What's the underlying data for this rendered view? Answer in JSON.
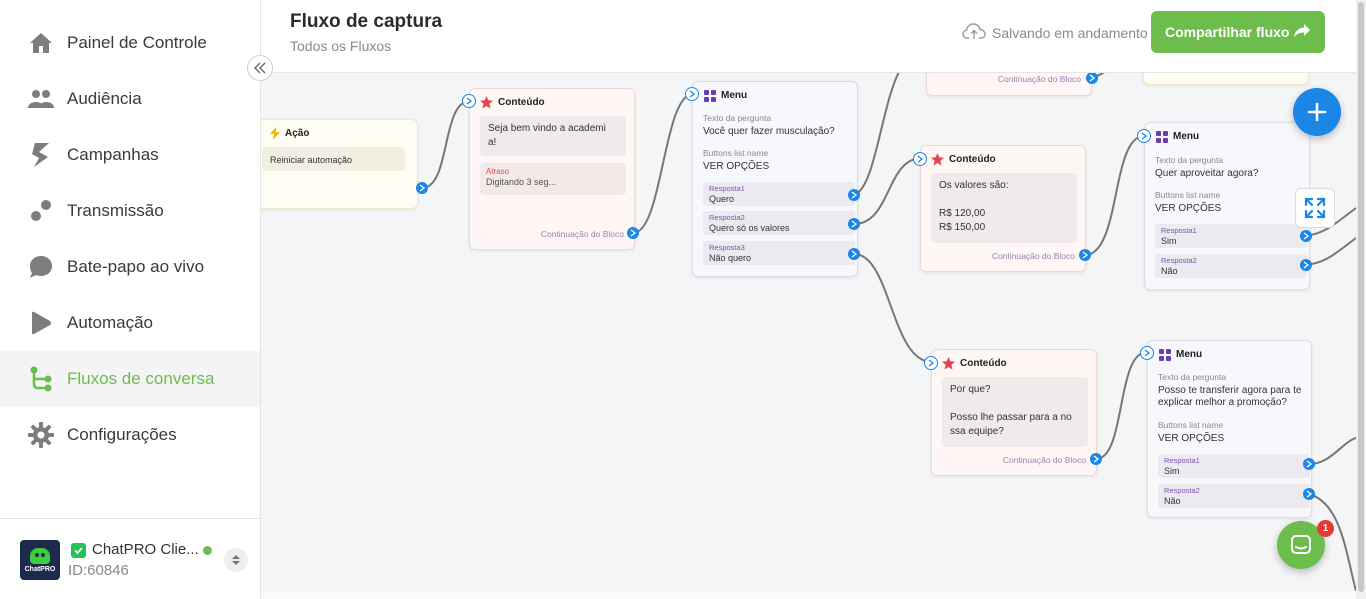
{
  "sidebar": {
    "items": [
      {
        "label": "Painel de Controle",
        "icon": "home-icon"
      },
      {
        "label": "Audiência",
        "icon": "users-icon"
      },
      {
        "label": "Campanhas",
        "icon": "campaign-icon"
      },
      {
        "label": "Transmissão",
        "icon": "broadcast-icon"
      },
      {
        "label": "Bate-papo ao vivo",
        "icon": "chat-bubble-icon"
      },
      {
        "label": "Automação",
        "icon": "play-icon"
      },
      {
        "label": "Fluxos de conversa",
        "icon": "flow-icon"
      },
      {
        "label": "Configurações",
        "icon": "gear-icon"
      }
    ],
    "account": {
      "name": "ChatPRO Clie...",
      "id": "ID:60846",
      "avatar_text": "ChatPRO"
    }
  },
  "header": {
    "title": "Fluxo de captura",
    "breadcrumb": "Todos os Fluxos",
    "save_status": "Salvando em andamento",
    "share_label": "Compartilhar fluxo"
  },
  "nodes": {
    "acao": {
      "title": "Ação",
      "text": "Reiniciar automação"
    },
    "conteudo1": {
      "title": "Conteúdo",
      "text1": "Seja bem vindo a academi",
      "text2": "a!",
      "delay_label": "Atraso",
      "delay_value": "Digitando 3 seg...",
      "continuation": "Continuação do Bloco"
    },
    "menu1": {
      "title": "Menu",
      "q_label": "Texto da pergunta",
      "q_text": "Você quer fazer musculação?",
      "bl_label": "Buttons list name",
      "bl_text": "VER OPÇÕES",
      "answers": [
        {
          "label": "Resposta1",
          "value": "Quero"
        },
        {
          "label": "Resposta2",
          "value": "Quero só os valores"
        },
        {
          "label": "Resposta3",
          "value": "Não quero"
        }
      ]
    },
    "top_partial": {
      "continuation": "Continuação do Bloco"
    },
    "conteudo2": {
      "title": "Conteúdo",
      "line1": "Os valores são:",
      "line2": "R$ 120,00",
      "line3": "R$ 150,00",
      "continuation": "Continuação do Bloco"
    },
    "menu2": {
      "title": "Menu",
      "q_label": "Texto da pergunta",
      "q_text": "Quer aproveitar agora?",
      "bl_label": "Buttons list name",
      "bl_text": "VER OPÇÕES",
      "answers": [
        {
          "label": "Resposta1",
          "value": "Sim"
        },
        {
          "label": "Resposta2",
          "value": "Não"
        }
      ]
    },
    "conteudo3": {
      "title": "Conteúdo",
      "line1": "Por que?",
      "line2": "Posso lhe passar para a no",
      "line3": "ssa equipe?",
      "continuation": "Continuação do Bloco"
    },
    "menu3": {
      "title": "Menu",
      "q_label": "Texto da pergunta",
      "q_line1": "Posso te transferir agora para te",
      "q_line2": "explicar melhor a promoção?",
      "bl_label": "Buttons list name",
      "bl_text": "VER OPÇÕES",
      "answers": [
        {
          "label": "Resposta1",
          "value": "Sim"
        },
        {
          "label": "Resposta2",
          "value": "Não"
        }
      ]
    }
  },
  "chat_badge": "1",
  "colors": {
    "brand_green": "#6dbd4d",
    "accent_blue": "#1a86e6",
    "menu_purple": "#7b52ad",
    "star_red": "#e0474c"
  }
}
